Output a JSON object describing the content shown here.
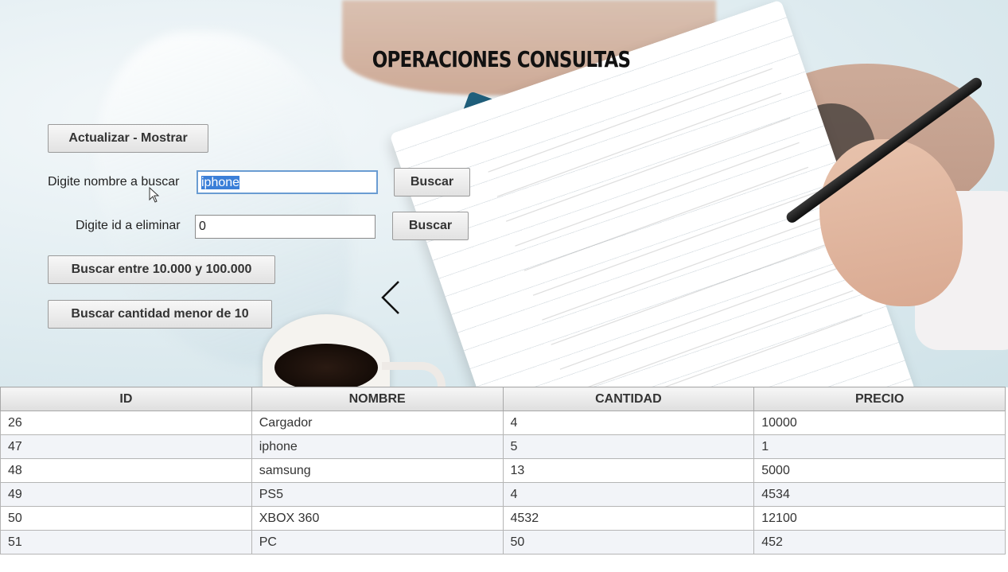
{
  "page": {
    "title": "OPERACIONES CONSULTAS"
  },
  "actions": {
    "refresh_label": "Actualizar - Mostrar",
    "search_name_label": "Digite nombre a buscar",
    "search_name_value": "iphone",
    "search_name_button": "Buscar",
    "delete_id_label": "Digite id a eliminar",
    "delete_id_value": "0",
    "delete_id_button": "Buscar",
    "range_button": "Buscar entre 10.000 y 100.000",
    "low_qty_button": "Buscar cantidad menor de 10"
  },
  "table": {
    "columns": [
      "ID",
      "NOMBRE",
      "CANTIDAD",
      "PRECIO"
    ],
    "rows": [
      [
        "26",
        "Cargador",
        "4",
        "10000"
      ],
      [
        "47",
        "iphone",
        "5",
        "1"
      ],
      [
        "48",
        "samsung",
        "13",
        "5000"
      ],
      [
        "49",
        "PS5",
        "4",
        "4534"
      ],
      [
        "50",
        "XBOX 360",
        "4532",
        "12100"
      ],
      [
        "51",
        "PC",
        "50",
        "452"
      ]
    ]
  },
  "icons": {
    "carousel_prev": "chevron-left-icon",
    "pointer": "mouse-cursor-icon"
  },
  "colors": {
    "selection": "#3b7fd8",
    "focus_border": "#6a9cd2"
  }
}
